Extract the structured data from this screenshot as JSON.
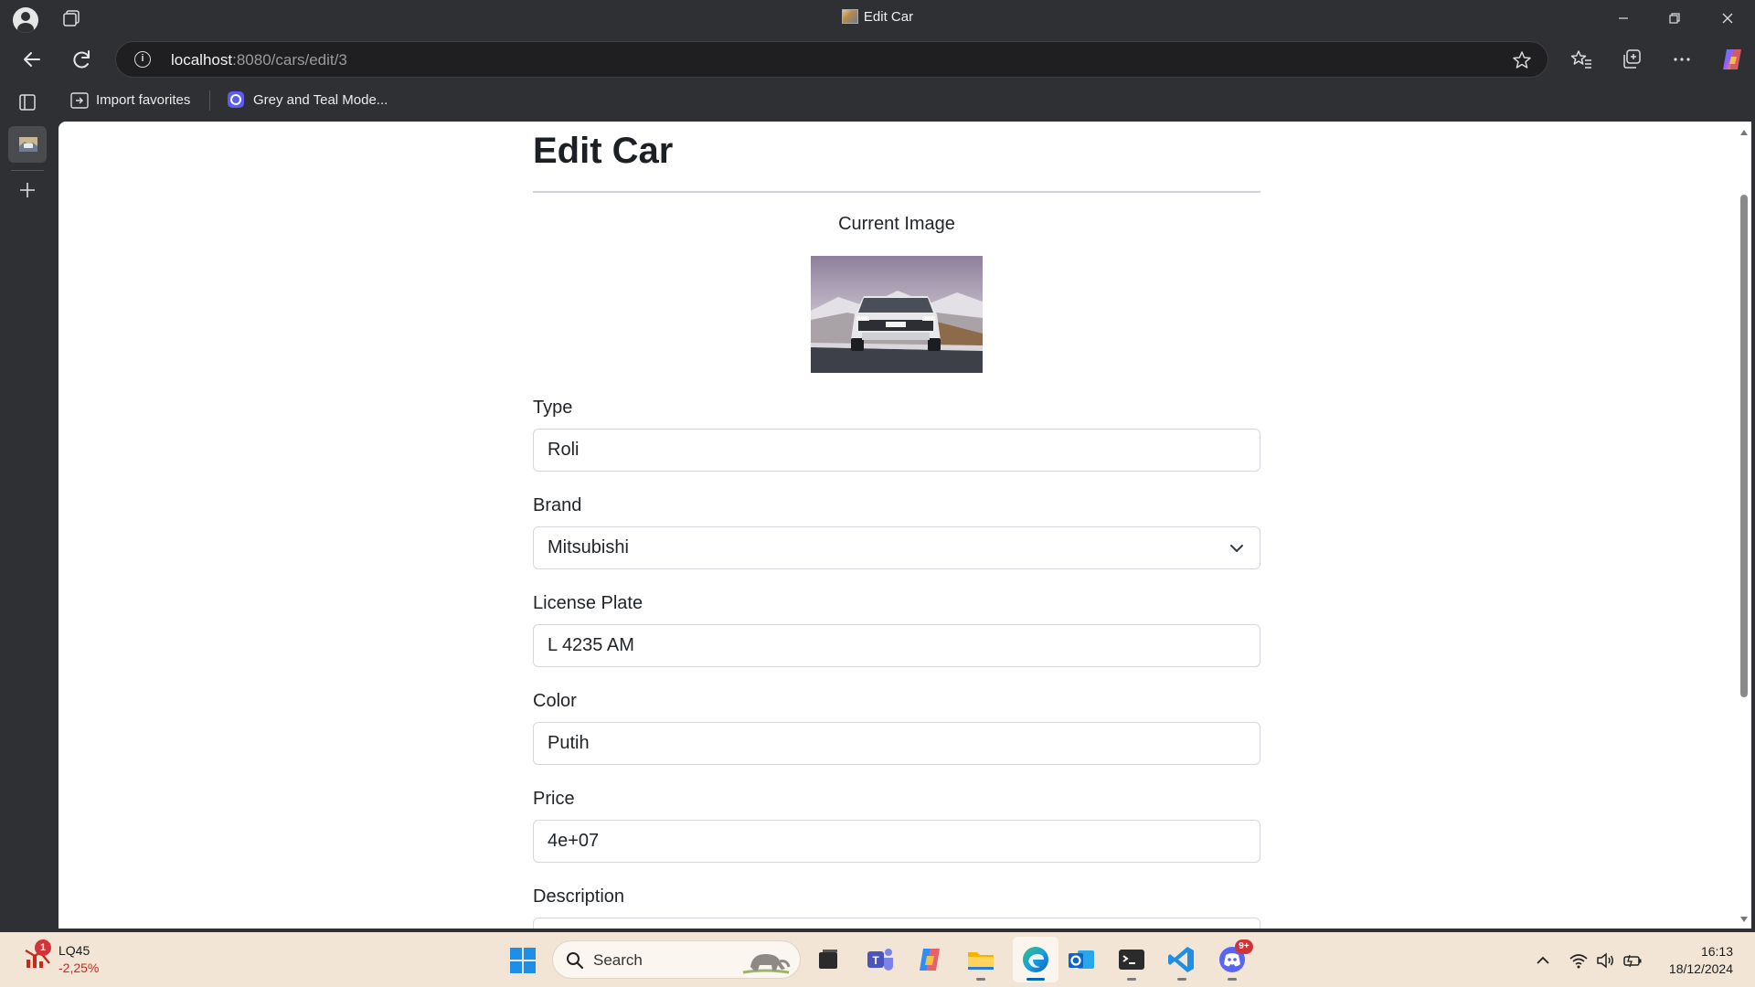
{
  "window": {
    "title": "Edit Car"
  },
  "addressbar": {
    "host": "localhost",
    "path": ":8080/cars/edit/3"
  },
  "bookmarks": [
    {
      "label": "Import favorites"
    },
    {
      "label": "Grey and Teal Mode..."
    }
  ],
  "page": {
    "title": "Edit Car",
    "current_image_label": "Current Image",
    "fields": {
      "type": {
        "label": "Type",
        "value": "Roli"
      },
      "brand": {
        "label": "Brand",
        "value": "Mitsubishi"
      },
      "license_plate": {
        "label": "License Plate",
        "value": "L 4235 AM"
      },
      "color": {
        "label": "Color",
        "value": "Putih"
      },
      "price": {
        "label": "Price",
        "value": "4e+07"
      },
      "description": {
        "label": "Description"
      }
    }
  },
  "taskbar": {
    "stock": {
      "name": "LQ45",
      "change": "-2,25%",
      "badge": "1"
    },
    "search_placeholder": "Search",
    "clock_time": "16:13",
    "clock_date": "18/12/2024",
    "discord_badge": "9+"
  },
  "colors": {
    "browser_chrome": "#2f3033",
    "page_background": "#ffffff",
    "taskbar": "#f3e5d6",
    "accent": "#0067c0"
  }
}
